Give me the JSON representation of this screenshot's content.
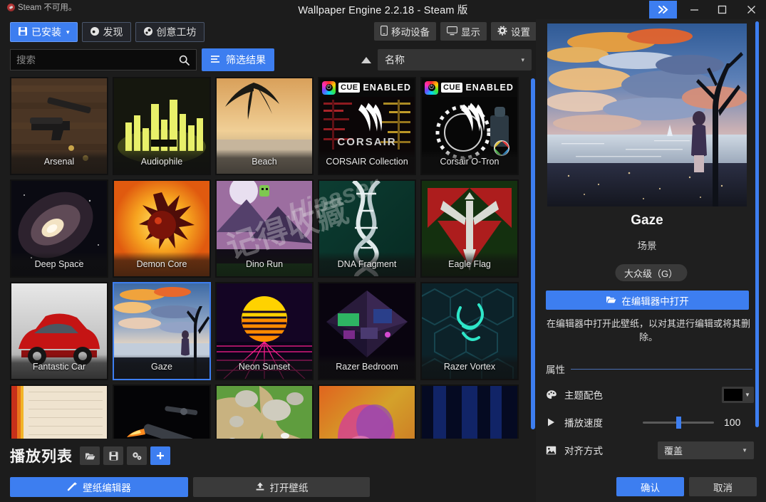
{
  "window": {
    "title": "Wallpaper Engine 2.2.18 - Steam 版",
    "steam_status": "Steam 不可用。",
    "controls": {
      "expand": "»",
      "minimize": "minimize-icon",
      "maximize": "maximize-icon",
      "close": "close-icon"
    }
  },
  "tabs": [
    {
      "label": "已安装",
      "icon": "save-icon",
      "active": true,
      "caret": "▾"
    },
    {
      "label": "发现",
      "icon": "discover-icon",
      "active": false
    },
    {
      "label": "创意工坊",
      "icon": "steam-icon",
      "active": false
    }
  ],
  "tools": [
    {
      "label": "移动设备",
      "icon": "phone-icon"
    },
    {
      "label": "显示",
      "icon": "monitor-icon"
    },
    {
      "label": "设置",
      "icon": "gear-icon"
    }
  ],
  "search": {
    "placeholder": "搜索",
    "value": "",
    "icon": "search-icon"
  },
  "filter_button": {
    "label": "筛选结果",
    "icon": "filter-icon"
  },
  "sort": {
    "direction_icon": "sort-ascending-icon",
    "selected": "名称",
    "caret": "▾"
  },
  "grid": {
    "items": [
      {
        "title": "Arsenal",
        "kind": "guns"
      },
      {
        "title": "Audiophile",
        "kind": "equalizer"
      },
      {
        "title": "Beach",
        "kind": "beach"
      },
      {
        "title": "CORSAIR Collection",
        "kind": "corsair",
        "banner": true
      },
      {
        "title": "Corsair O-Tron",
        "kind": "corsair-otron",
        "banner": true
      },
      {
        "title": "Deep Space",
        "kind": "galaxy"
      },
      {
        "title": "Demon Core",
        "kind": "demoncore"
      },
      {
        "title": "Dino Run",
        "kind": "dinorun"
      },
      {
        "title": "DNA Fragment",
        "kind": "dna"
      },
      {
        "title": "Eagle Flag",
        "kind": "eagle"
      },
      {
        "title": "Fantastic Car",
        "kind": "car"
      },
      {
        "title": "Gaze",
        "kind": "gaze",
        "selected": true
      },
      {
        "title": "Neon Sunset",
        "kind": "neon"
      },
      {
        "title": "Razer Bedroom",
        "kind": "bedroom"
      },
      {
        "title": "Razer Vortex",
        "kind": "vortex"
      },
      {
        "title": "",
        "kind": "paper"
      },
      {
        "title": "",
        "kind": "rocket"
      },
      {
        "title": "",
        "kind": "sheep"
      },
      {
        "title": "",
        "kind": "bokeh"
      },
      {
        "title": "",
        "kind": "bluehex"
      }
    ],
    "cue_banner": {
      "badge": "CUE",
      "text": "ENABLED"
    },
    "corsair_word": "CORSAIR",
    "watermark_1": "记得收藏",
    "watermark_2": "Hipaser"
  },
  "playlist": {
    "title": "播放列表",
    "buttons": [
      {
        "icon": "folder-open-icon",
        "name": "open-playlist"
      },
      {
        "icon": "save-icon",
        "name": "save-playlist"
      },
      {
        "icon": "settings-gears-icon",
        "name": "playlist-settings"
      },
      {
        "icon": "plus-icon",
        "name": "add-playlist",
        "accent": true
      }
    ]
  },
  "bottom_buttons": [
    {
      "label": "壁纸编辑器",
      "icon": "wand-icon",
      "primary": true
    },
    {
      "label": "打开壁纸",
      "icon": "upload-icon",
      "primary": false
    }
  ],
  "details": {
    "wallpaper_title": "Gaze",
    "wallpaper_type": "场景",
    "rating_badge": "大众级（G）",
    "open_editor_button": {
      "label": "在编辑器中打开",
      "icon": "folder-icon"
    },
    "editor_description": "在编辑器中打开此壁纸，以对其进行编辑或将其删除。",
    "properties_heading": "属性",
    "properties": [
      {
        "icon": "palette-icon",
        "label": "主题配色",
        "control": "color",
        "value": "#000000"
      },
      {
        "icon": "play-icon",
        "label": "播放速度",
        "control": "slider",
        "value": "100",
        "min": 0,
        "max": 200
      },
      {
        "icon": "image-icon",
        "label": "对齐方式",
        "control": "select",
        "value": "覆盖"
      }
    ],
    "confirm_button": "确认",
    "cancel_button": "取消"
  },
  "colors": {
    "accent": "#3d7ef0",
    "bg": "#1c1c1c",
    "panel_bg": "#1f1f1f",
    "button_bg": "#3a3a3a"
  }
}
